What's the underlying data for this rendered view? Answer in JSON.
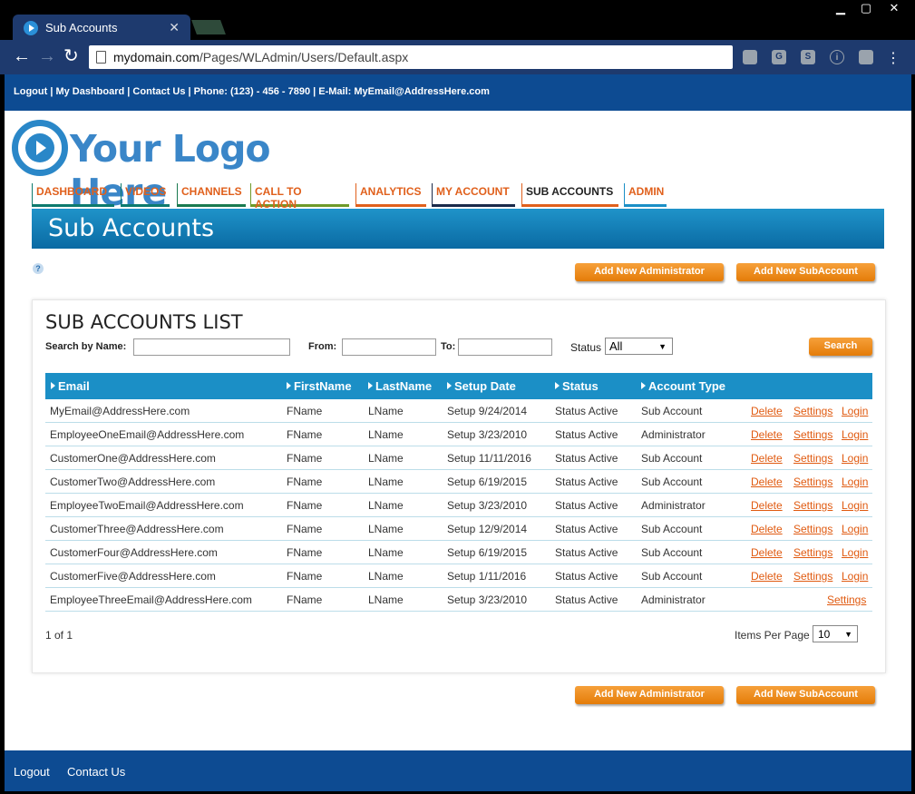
{
  "browser": {
    "tab_title": "Sub Accounts",
    "tab_close": "✕",
    "url_domain": "mydomain.com",
    "url_path": "/Pages/WLAdmin/Users/Default.aspx",
    "ext_icons": [
      "G",
      "S",
      "i"
    ]
  },
  "topbar": {
    "links": "Logout | My Dashboard | Contact Us | Phone: (123) - 456 - 7890 | E-Mail: MyEmail@AddressHere.com"
  },
  "logo": {
    "text": "Your Logo Here"
  },
  "nav": [
    {
      "label": "DASHBOARD",
      "color": "#e0601c",
      "border": "#0d7a6e"
    },
    {
      "label": "VIDEOS",
      "color": "#e0601c",
      "border": "#0d7a6e"
    },
    {
      "label": "CHANNELS",
      "color": "#e0601c",
      "border": "#1a7a50"
    },
    {
      "label": "CALL TO ACTION",
      "color": "#e0601c",
      "border": "#6e9a2a"
    },
    {
      "label": "ANALYTICS",
      "color": "#e0601c",
      "border": "#e0601c"
    },
    {
      "label": "MY ACCOUNT",
      "color": "#e0601c",
      "border": "#1a2a4a"
    },
    {
      "label": "SUB ACCOUNTS",
      "color": "#222222",
      "border": "#e0601c"
    },
    {
      "label": "ADMIN",
      "color": "#e0601c",
      "border": "#1b8fc6"
    }
  ],
  "banner": {
    "title": "Sub Accounts"
  },
  "help": "?",
  "buttons": {
    "add_admin": "Add New Administrator",
    "add_sub": "Add New SubAccount",
    "search": "Search"
  },
  "filters": {
    "title": "SUB ACCOUNTS LIST",
    "search_by_name": "Search by Name:",
    "from": "From:",
    "to": "To:",
    "status_label": "Status",
    "status_value": "All"
  },
  "table": {
    "headers": [
      "Email",
      "FirstName",
      "LastName",
      "Setup Date",
      "Status",
      "Account Type"
    ],
    "rows": [
      {
        "email": "MyEmail@AddressHere.com",
        "first": "FName",
        "last": "LName",
        "setup": "Setup 9/24/2014",
        "status": "Status Active",
        "type": "Sub Account",
        "actions": [
          "Delete",
          "Settings",
          "Login"
        ]
      },
      {
        "email": "EmployeeOneEmail@AddressHere.com",
        "first": "FName",
        "last": "LName",
        "setup": "Setup 3/23/2010",
        "status": "Status Active",
        "type": "Administrator",
        "actions": [
          "Delete",
          "Settings",
          "Login"
        ]
      },
      {
        "email": "CustomerOne@AddressHere.com",
        "first": "FName",
        "last": "LName",
        "setup": "Setup 11/11/2016",
        "status": "Status Active",
        "type": "Sub Account",
        "actions": [
          "Delete",
          "Settings",
          "Login"
        ]
      },
      {
        "email": "CustomerTwo@AddressHere.com",
        "first": "FName",
        "last": "LName",
        "setup": "Setup 6/19/2015",
        "status": "Status Active",
        "type": "Sub Account",
        "actions": [
          "Delete",
          "Settings",
          "Login"
        ]
      },
      {
        "email": "EmployeeTwoEmail@AddressHere.com",
        "first": "FName",
        "last": "LName",
        "setup": "Setup 3/23/2010",
        "status": "Status Active",
        "type": "Administrator",
        "actions": [
          "Delete",
          "Settings",
          "Login"
        ]
      },
      {
        "email": "CustomerThree@AddressHere.com",
        "first": "FName",
        "last": "LName",
        "setup": "Setup 12/9/2014",
        "status": "Status Active",
        "type": "Sub Account",
        "actions": [
          "Delete",
          "Settings",
          "Login"
        ]
      },
      {
        "email": "CustomerFour@AddressHere.com",
        "first": "FName",
        "last": "LName",
        "setup": "Setup 6/19/2015",
        "status": "Status Active",
        "type": "Sub Account",
        "actions": [
          "Delete",
          "Settings",
          "Login"
        ]
      },
      {
        "email": "CustomerFive@AddressHere.com",
        "first": "FName",
        "last": "LName",
        "setup": "Setup 1/11/2016",
        "status": "Status Active",
        "type": "Sub Account",
        "actions": [
          "Delete",
          "Settings",
          "Login"
        ]
      },
      {
        "email": "EmployeeThreeEmail@AddressHere.com",
        "first": "FName",
        "last": "LName",
        "setup": "Setup 3/23/2010",
        "status": "Status Active",
        "type": "Administrator",
        "actions": [
          "Settings"
        ]
      }
    ]
  },
  "pager": {
    "text": "1 of 1",
    "items_label": "Items Per Page",
    "items_value": "10"
  },
  "footer": {
    "logout": "Logout",
    "contact": "Contact Us"
  },
  "colors": {
    "brand_blue": "#0d4b92",
    "accent_orange": "#e0601c",
    "header_blue": "#1b8fc6"
  }
}
